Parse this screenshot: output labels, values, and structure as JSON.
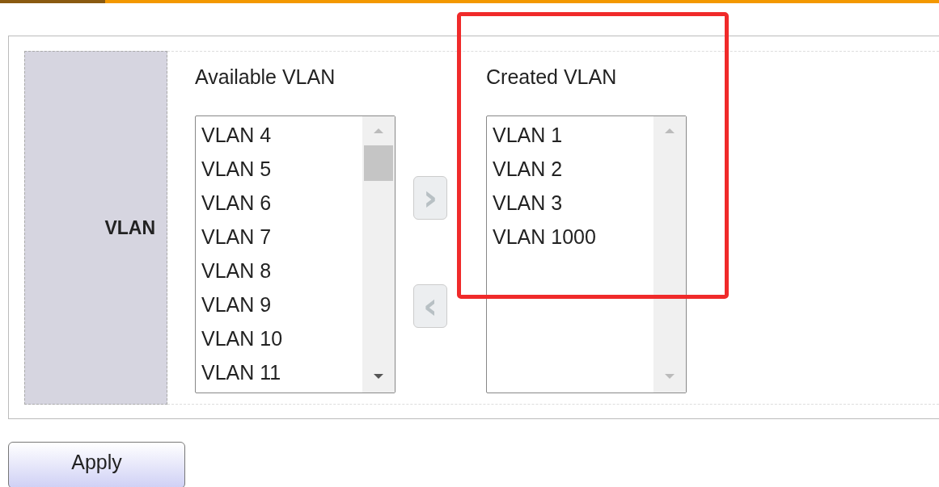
{
  "row_label": "VLAN",
  "available": {
    "title": "Available VLAN",
    "items": [
      "VLAN 4",
      "VLAN 5",
      "VLAN 6",
      "VLAN 7",
      "VLAN 8",
      "VLAN 9",
      "VLAN 10",
      "VLAN 11"
    ]
  },
  "move_buttons": [
    {
      "symbol": "›",
      "disabled": true
    },
    {
      "symbol": "‹",
      "disabled": true
    }
  ],
  "created": {
    "title": "Created VLAN",
    "items": [
      "VLAN 1",
      "VLAN 2",
      "VLAN 3",
      "VLAN 1000"
    ]
  },
  "apply_button": "Apply"
}
